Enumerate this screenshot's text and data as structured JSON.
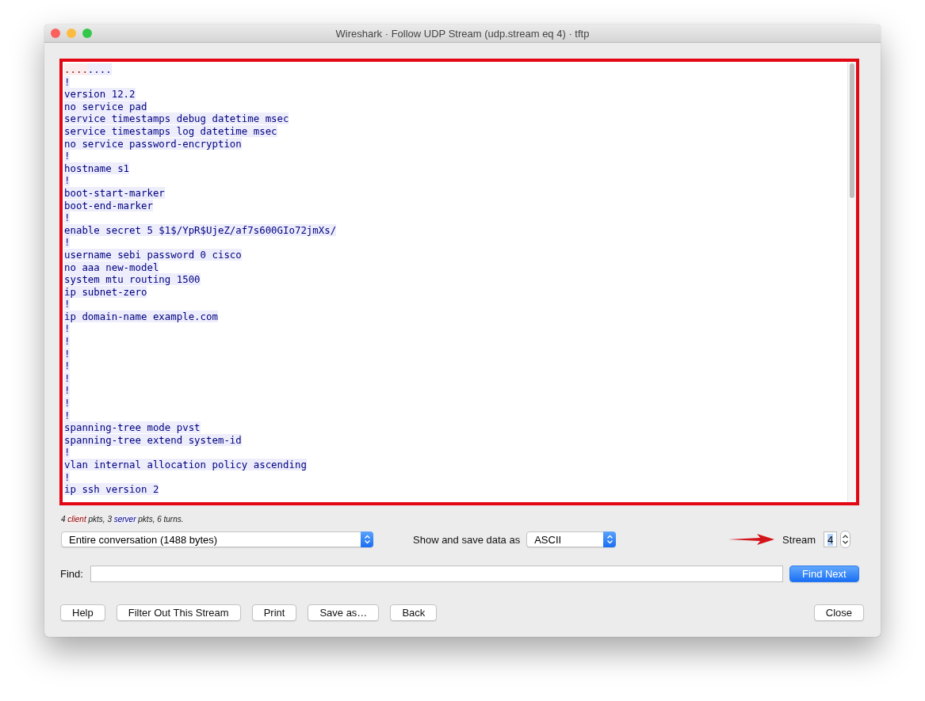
{
  "window": {
    "title": "Wireshark · Follow UDP Stream (udp.stream eq 4) · tftp"
  },
  "stream_lines": [
    {
      "segments": [
        {
          "kind": "client",
          "text": "...."
        },
        {
          "kind": "server",
          "text": "...."
        }
      ]
    },
    {
      "segments": [
        {
          "kind": "server",
          "text": "!"
        }
      ]
    },
    {
      "segments": [
        {
          "kind": "server",
          "text": "version 12.2"
        }
      ]
    },
    {
      "segments": [
        {
          "kind": "server",
          "text": "no service pad"
        }
      ]
    },
    {
      "segments": [
        {
          "kind": "server",
          "text": "service timestamps debug datetime msec"
        }
      ]
    },
    {
      "segments": [
        {
          "kind": "server",
          "text": "service timestamps log datetime msec"
        }
      ]
    },
    {
      "segments": [
        {
          "kind": "server",
          "text": "no service password-encryption"
        }
      ]
    },
    {
      "segments": [
        {
          "kind": "server",
          "text": "!"
        }
      ]
    },
    {
      "segments": [
        {
          "kind": "server",
          "text": "hostname s1"
        }
      ]
    },
    {
      "segments": [
        {
          "kind": "server",
          "text": "!"
        }
      ]
    },
    {
      "segments": [
        {
          "kind": "server",
          "text": "boot-start-marker"
        }
      ]
    },
    {
      "segments": [
        {
          "kind": "server",
          "text": "boot-end-marker"
        }
      ]
    },
    {
      "segments": [
        {
          "kind": "server",
          "text": "!"
        }
      ]
    },
    {
      "segments": [
        {
          "kind": "server",
          "text": "enable secret 5 $1$/YpR$UjeZ/af7s600GIo72jmXs/"
        }
      ]
    },
    {
      "segments": [
        {
          "kind": "server",
          "text": "!"
        }
      ]
    },
    {
      "segments": [
        {
          "kind": "server",
          "text": "username sebi password 0 cisco"
        }
      ]
    },
    {
      "segments": [
        {
          "kind": "server",
          "text": "no aaa new-model"
        }
      ]
    },
    {
      "segments": [
        {
          "kind": "server",
          "text": "system mtu routing 1500"
        }
      ]
    },
    {
      "segments": [
        {
          "kind": "server",
          "text": "ip subnet-zero"
        }
      ]
    },
    {
      "segments": [
        {
          "kind": "server",
          "text": "!"
        }
      ]
    },
    {
      "segments": [
        {
          "kind": "server",
          "text": "ip domain-name example.com"
        }
      ]
    },
    {
      "segments": [
        {
          "kind": "server",
          "text": "!"
        }
      ]
    },
    {
      "segments": [
        {
          "kind": "server",
          "text": "!"
        }
      ]
    },
    {
      "segments": [
        {
          "kind": "server",
          "text": "!"
        }
      ]
    },
    {
      "segments": [
        {
          "kind": "server",
          "text": "!"
        }
      ]
    },
    {
      "segments": [
        {
          "kind": "server",
          "text": "!"
        }
      ]
    },
    {
      "segments": [
        {
          "kind": "server",
          "text": "!"
        }
      ]
    },
    {
      "segments": [
        {
          "kind": "server",
          "text": "!"
        }
      ]
    },
    {
      "segments": [
        {
          "kind": "server",
          "text": "!"
        }
      ]
    },
    {
      "segments": [
        {
          "kind": "server",
          "text": "spanning-tree mode pvst"
        }
      ]
    },
    {
      "segments": [
        {
          "kind": "server",
          "text": "spanning-tree extend system-id"
        }
      ]
    },
    {
      "segments": [
        {
          "kind": "server",
          "text": "!"
        }
      ]
    },
    {
      "segments": [
        {
          "kind": "server",
          "text": "vlan internal allocation policy ascending"
        }
      ]
    },
    {
      "segments": [
        {
          "kind": "server",
          "text": "!"
        }
      ]
    },
    {
      "segments": [
        {
          "kind": "server",
          "text": "ip ssh version 2"
        }
      ]
    }
  ],
  "summary": [
    {
      "kind": "plain",
      "text": "4 "
    },
    {
      "kind": "client",
      "text": "client"
    },
    {
      "kind": "plain",
      "text": " pkts, 3 "
    },
    {
      "kind": "server",
      "text": "server"
    },
    {
      "kind": "plain",
      "text": " pkts, 6 turns."
    }
  ],
  "conversation_select": {
    "value": "Entire conversation (1488 bytes)"
  },
  "format_label": "Show and save data as",
  "format_select": {
    "value": "ASCII"
  },
  "stream_label": "Stream",
  "stream_number": {
    "value": "4"
  },
  "find": {
    "label": "Find:",
    "button": "Find Next"
  },
  "buttons": [
    "Help",
    "Filter Out This Stream",
    "Print",
    "Save as…",
    "Back"
  ],
  "close_button": "Close"
}
